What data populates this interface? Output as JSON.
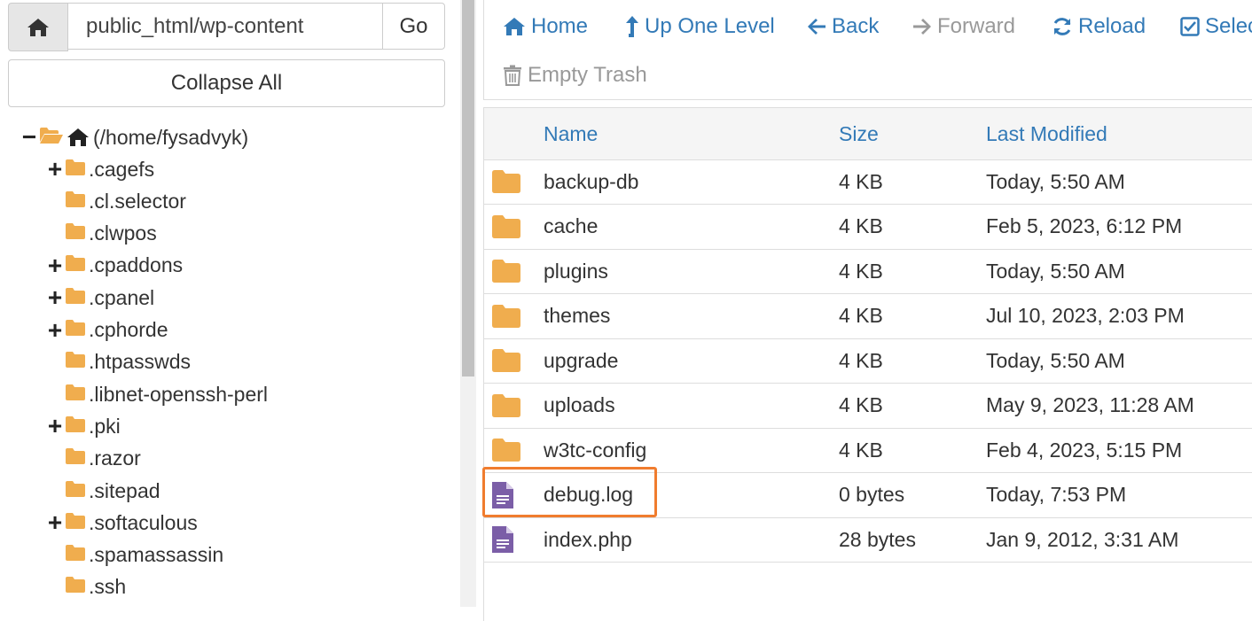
{
  "path_bar": {
    "value": "public_html/wp-content",
    "go_label": "Go"
  },
  "collapse_label": "Collapse All",
  "tree": {
    "root_label": "(/home/fysadvyk)",
    "items": [
      {
        "label": ".cagefs",
        "expandable": true
      },
      {
        "label": ".cl.selector",
        "expandable": false
      },
      {
        "label": ".clwpos",
        "expandable": false
      },
      {
        "label": ".cpaddons",
        "expandable": true
      },
      {
        "label": ".cpanel",
        "expandable": true
      },
      {
        "label": ".cphorde",
        "expandable": true
      },
      {
        "label": ".htpasswds",
        "expandable": false
      },
      {
        "label": ".libnet-openssh-perl",
        "expandable": false
      },
      {
        "label": ".pki",
        "expandable": true
      },
      {
        "label": ".razor",
        "expandable": false
      },
      {
        "label": ".sitepad",
        "expandable": false
      },
      {
        "label": ".softaculous",
        "expandable": true
      },
      {
        "label": ".spamassassin",
        "expandable": false
      },
      {
        "label": ".ssh",
        "expandable": false
      }
    ]
  },
  "toolbar": {
    "home": "Home",
    "up_one_level": "Up One Level",
    "back": "Back",
    "forward": "Forward",
    "reload": "Reload",
    "select_all": "Selec",
    "empty_trash": "Empty Trash"
  },
  "table": {
    "headers": {
      "name": "Name",
      "size": "Size",
      "modified": "Last Modified"
    },
    "rows": [
      {
        "type": "folder",
        "name": "backup-db",
        "size": "4 KB",
        "modified": "Today, 5:50 AM"
      },
      {
        "type": "folder",
        "name": "cache",
        "size": "4 KB",
        "modified": "Feb 5, 2023, 6:12 PM"
      },
      {
        "type": "folder",
        "name": "plugins",
        "size": "4 KB",
        "modified": "Today, 5:50 AM"
      },
      {
        "type": "folder",
        "name": "themes",
        "size": "4 KB",
        "modified": "Jul 10, 2023, 2:03 PM"
      },
      {
        "type": "folder",
        "name": "upgrade",
        "size": "4 KB",
        "modified": "Today, 5:50 AM"
      },
      {
        "type": "folder",
        "name": "uploads",
        "size": "4 KB",
        "modified": "May 9, 2023, 11:28 AM"
      },
      {
        "type": "folder",
        "name": "w3tc-config",
        "size": "4 KB",
        "modified": "Feb 4, 2023, 5:15 PM"
      },
      {
        "type": "file",
        "name": "debug.log",
        "size": "0 bytes",
        "modified": "Today, 7:53 PM"
      },
      {
        "type": "file",
        "name": "index.php",
        "size": "28 bytes",
        "modified": "Jan 9, 2012, 3:31 AM"
      }
    ]
  },
  "colors": {
    "link": "#337ab7",
    "folder": "#f0ad4e",
    "file": "#7b5ea7",
    "highlight": "#f07c2e"
  }
}
